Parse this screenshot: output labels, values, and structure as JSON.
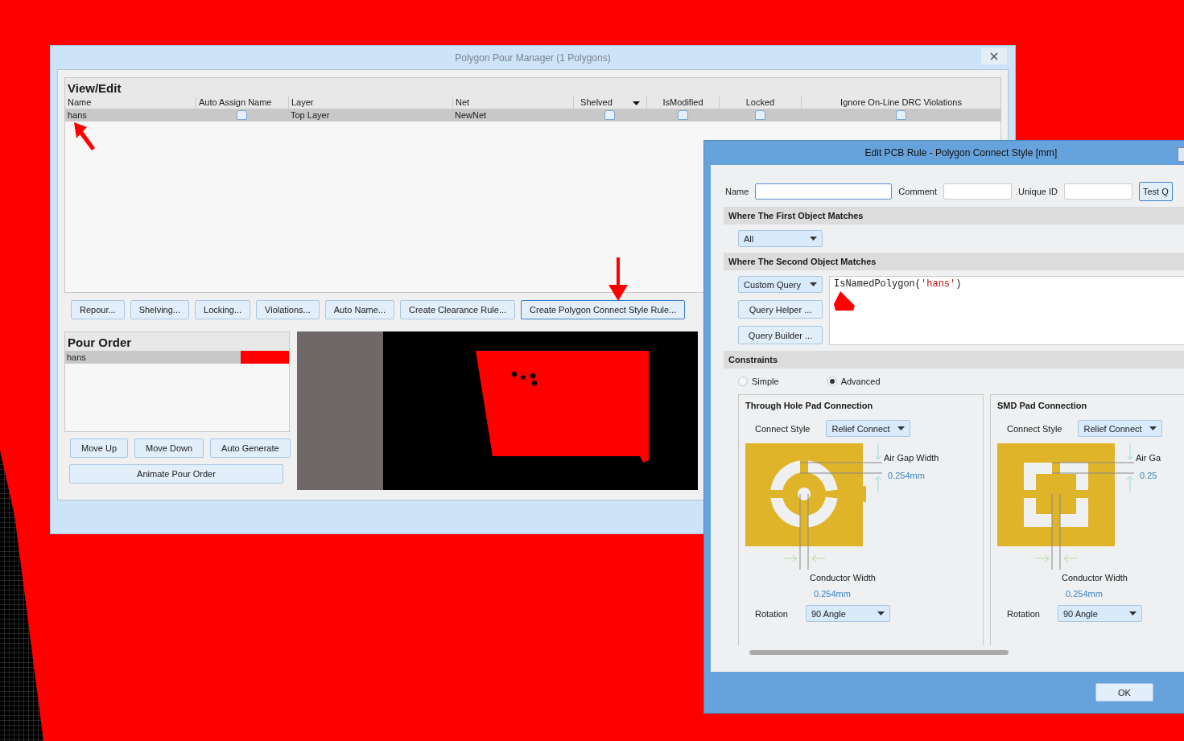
{
  "manager": {
    "title": "Polygon Pour Manager (1 Polygons)",
    "view_edit": {
      "heading": "View/Edit",
      "columns": [
        "Name",
        "Auto Assign Name",
        "Layer",
        "Net",
        "Shelved",
        "IsModified",
        "Locked",
        "Ignore On-Line DRC Violations"
      ],
      "rows": [
        {
          "name": "hans",
          "auto_assign_name": false,
          "layer": "Top Layer",
          "net": "NewNet",
          "shelved": false,
          "is_modified": false,
          "locked": false,
          "ignore_drc": false,
          "selected": true
        }
      ]
    },
    "buttons": [
      {
        "label": "Repour...",
        "selected": false
      },
      {
        "label": "Shelving...",
        "selected": false
      },
      {
        "label": "Locking...",
        "selected": false
      },
      {
        "label": "Violations...",
        "selected": false
      },
      {
        "label": "Auto Name...",
        "selected": false
      },
      {
        "label": "Create Clearance Rule...",
        "selected": false
      },
      {
        "label": "Create Polygon Connect Style Rule...",
        "selected": true
      }
    ],
    "pour_order": {
      "heading": "Pour Order",
      "items": [
        {
          "name": "hans",
          "color": "#ff0000",
          "selected": true
        }
      ]
    },
    "pour_buttons": [
      "Move Up",
      "Move Down",
      "Auto Generate"
    ],
    "animate_button": "Animate Pour Order"
  },
  "dialog": {
    "title": "Edit PCB Rule - Polygon Connect Style [mm]",
    "fields": [
      {
        "label": "Name",
        "focused": true
      },
      {
        "label": "Comment",
        "focused": false
      },
      {
        "label": "Unique ID",
        "focused": false
      }
    ],
    "test_button": "Test Q",
    "first_match": {
      "heading": "Where The First Object Matches",
      "dropdown": "All"
    },
    "second_match": {
      "heading": "Where The Second Object Matches",
      "dropdown": "Custom Query",
      "buttons": [
        "Query Helper ...",
        "Query Builder ..."
      ],
      "query": [
        {
          "text": "IsNamedPolygon(",
          "kind": "plain"
        },
        {
          "text": "'hans'",
          "kind": "string"
        },
        {
          "text": ")",
          "kind": "plain"
        }
      ]
    },
    "constraints": {
      "heading": "Constraints",
      "modes": [
        {
          "label": "Simple",
          "selected": false
        },
        {
          "label": "Advanced",
          "selected": true
        }
      ],
      "panels": [
        {
          "title": "Through Hole Pad Connection",
          "kind": "through_hole",
          "connect_style_label": "Connect Style",
          "connect_style": "Relief Connect",
          "air_gap_label": "Air Gap Width",
          "air_gap": "0.254mm",
          "conductor_label": "Conductor Width",
          "conductor": "0.254mm",
          "rotation_label": "Rotation",
          "rotation": "90 Angle"
        },
        {
          "title": "SMD Pad Connection",
          "kind": "smd",
          "connect_style_label": "Connect Style",
          "connect_style": "Relief Connect",
          "air_gap_label": "Air Ga",
          "air_gap": "0.25",
          "conductor_label": "Conductor Width",
          "conductor": "0.254mm",
          "rotation_label": "Rotation",
          "rotation": "90 Angle"
        }
      ]
    },
    "ok_button": "OK"
  }
}
